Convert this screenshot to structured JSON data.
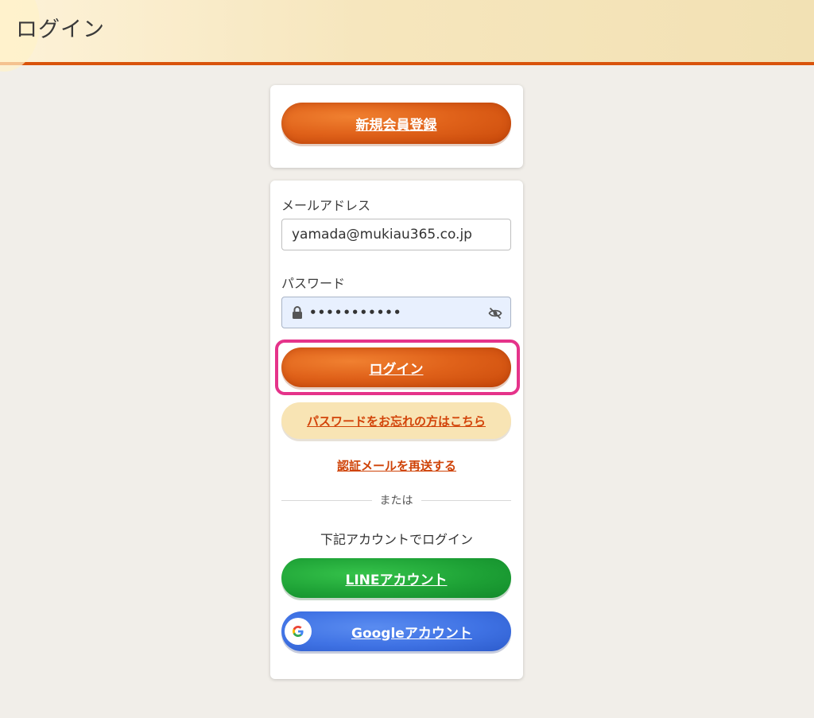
{
  "header": {
    "title": "ログイン"
  },
  "register": {
    "label": "新規会員登録"
  },
  "login_form": {
    "email_label": "メールアドレス",
    "email_value": "yamada@mukiau365.co.jp",
    "password_label": "パスワード",
    "password_mask": "•••••••••••",
    "login_label": "ログイン",
    "forgot_label": "パスワードをお忘れの方はこちら",
    "resend_label": "認証メールを再送する"
  },
  "divider": {
    "text": "または"
  },
  "social": {
    "heading": "下記アカウントでログイン",
    "line_label": "LINEアカウント",
    "google_label": "Googleアカウント"
  },
  "colors": {
    "accent": "#e0621a",
    "highlight": "#e5338a",
    "line_green": "#1ea236",
    "google_blue": "#3f72e4"
  }
}
